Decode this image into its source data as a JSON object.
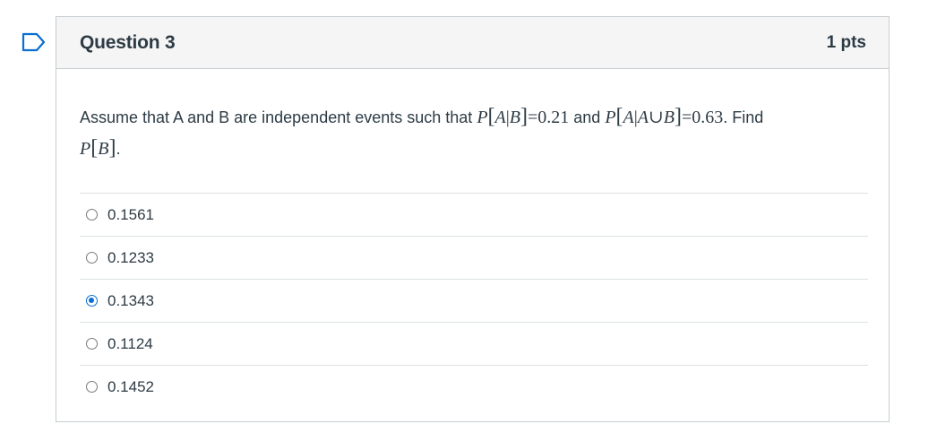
{
  "question": {
    "title": "Question 3",
    "points": "1 pts",
    "text_intro": "Assume that A and B are independent events such that ",
    "math1_value": "0.21",
    "text_and": " and ",
    "math2_value": "0.63",
    "text_find": ". Find ",
    "text_end": ".",
    "accent_color": "#0b6ed0"
  },
  "answers": [
    {
      "label": "0.1561",
      "selected": false
    },
    {
      "label": "0.1233",
      "selected": false
    },
    {
      "label": "0.1343",
      "selected": true
    },
    {
      "label": "0.1124",
      "selected": false
    },
    {
      "label": "0.1452",
      "selected": false
    }
  ],
  "icons": {
    "flag": "bookmark-flag-icon"
  }
}
